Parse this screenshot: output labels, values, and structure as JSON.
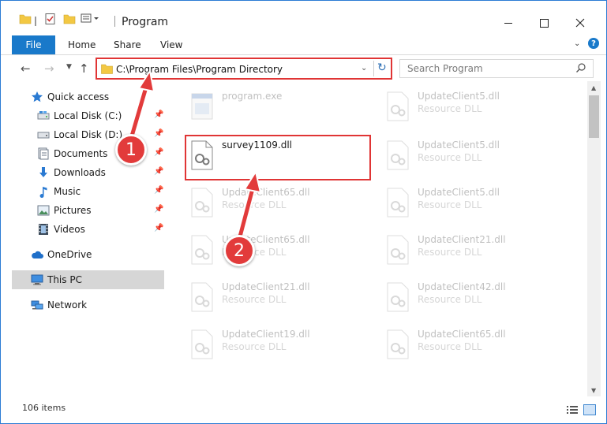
{
  "window": {
    "title": "Program",
    "controls": {
      "minimize_icon": "minimize-icon",
      "maximize_icon": "maximize-icon",
      "close_icon": "close-icon"
    }
  },
  "ribbon": {
    "tabs": [
      "File",
      "Home",
      "Share",
      "View"
    ],
    "active_tab": "File",
    "help_label": "?"
  },
  "navigation": {
    "address": "C:\\Program Files\\Program Directory",
    "search_placeholder": "Search Program"
  },
  "sidebar": {
    "items": [
      {
        "label": "Quick access",
        "icon": "star-icon",
        "level": 0
      },
      {
        "label": "Local Disk (C:)",
        "icon": "drive-icon",
        "level": 1,
        "pinned": true
      },
      {
        "label": "Local Disk (D:)",
        "icon": "drive-icon",
        "level": 1,
        "pinned": true
      },
      {
        "label": "Documents",
        "icon": "documents-icon",
        "level": 1,
        "pinned": true
      },
      {
        "label": "Downloads",
        "icon": "download-icon",
        "level": 1,
        "pinned": true
      },
      {
        "label": "Music",
        "icon": "music-icon",
        "level": 1,
        "pinned": true
      },
      {
        "label": "Pictures",
        "icon": "pictures-icon",
        "level": 1,
        "pinned": true
      },
      {
        "label": "Videos",
        "icon": "videos-icon",
        "level": 1,
        "pinned": true
      },
      {
        "label": "OneDrive",
        "icon": "cloud-icon",
        "level": 0
      },
      {
        "label": "This PC",
        "icon": "computer-icon",
        "level": 0,
        "selected": true
      },
      {
        "label": "Network",
        "icon": "network-icon",
        "level": 0
      }
    ]
  },
  "files": [
    {
      "name": "program.exe",
      "type": "",
      "faded": true
    },
    {
      "name": "UpdateClient5.dll",
      "type": "Resource DLL",
      "faded": true
    },
    {
      "name": "survey1109.dll",
      "type": "",
      "faded": false,
      "highlighted": true
    },
    {
      "name": "UpdateClient5.dll",
      "type": "Resource DLL",
      "faded": true
    },
    {
      "name": "UpdateClient65.dll",
      "type": "Resource DLL",
      "faded": true
    },
    {
      "name": "UpdateClient5.dll",
      "type": "Resource DLL",
      "faded": true
    },
    {
      "name": "UpdateClient65.dll",
      "type": "Resource DLL",
      "faded": true
    },
    {
      "name": "UpdateClient21.dll",
      "type": "Resource DLL",
      "faded": true
    },
    {
      "name": "UpdateClient21.dll",
      "type": "Resource DLL",
      "faded": true
    },
    {
      "name": "UpdateClient42.dll",
      "type": "Resource DLL",
      "faded": true
    },
    {
      "name": "UpdateClient19.dll",
      "type": "Resource DLL",
      "faded": true
    },
    {
      "name": "UpdateClient65.dll",
      "type": "Resource DLL",
      "faded": true
    }
  ],
  "status": {
    "item_count": "106 items"
  },
  "annotations": {
    "step1": "1",
    "step2": "2",
    "color": "#e23b3b"
  },
  "colors": {
    "accent": "#1979ca",
    "highlight": "#e03535"
  }
}
